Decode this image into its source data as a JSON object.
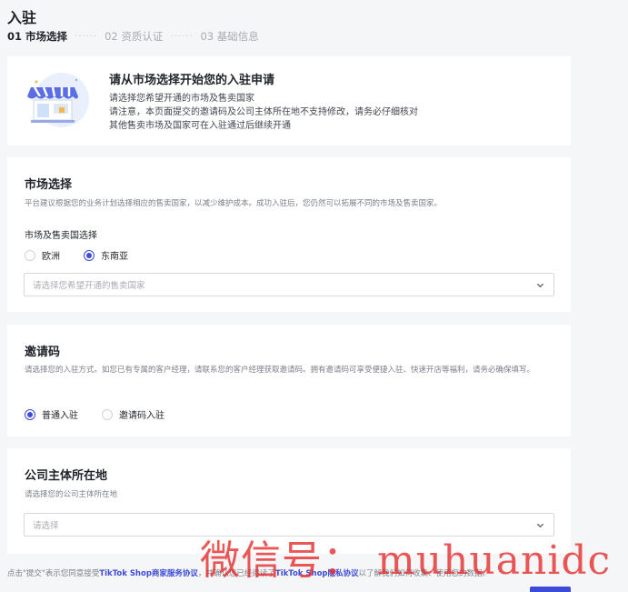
{
  "page": {
    "title": "入驻"
  },
  "steps": [
    {
      "label": "01 市场选择",
      "active": true
    },
    {
      "label": "02 资质认证",
      "active": false
    },
    {
      "label": "03 基础信息",
      "active": false
    }
  ],
  "step_separator": "······",
  "hero": {
    "title": "请从市场选择开始您的入驻申请",
    "lines": [
      "请选择您希望开通的市场及售卖国家",
      "请注意，本页面提交的邀请码及公司主体所在地不支持修改，请务必仔细核对",
      "其他售卖市场及国家可在入驻通过后继续开通"
    ]
  },
  "market": {
    "title": "市场选择",
    "desc": "平台建议根据您的业务计划选择相应的售卖国家，以减少维护成本。成功入驻后，您仍然可以拓展不同的市场及售卖国家。",
    "field_label": "市场及售卖国选择",
    "options": [
      {
        "label": "欧洲",
        "checked": false
      },
      {
        "label": "东南亚",
        "checked": true
      }
    ],
    "select_placeholder": "请选择您希望开通的售卖国家"
  },
  "invite": {
    "title": "邀请码",
    "desc": "请选择您的入驻方式。如您已有专属的客户经理，请联系您的客户经理获取邀请码。拥有邀请码可享受便捷入驻、快速开店等福利，请务必确保填写。",
    "options": [
      {
        "label": "普通入驻",
        "checked": true
      },
      {
        "label": "邀请码入驻",
        "checked": false
      }
    ]
  },
  "company": {
    "title": "公司主体所在地",
    "desc": "请选择您的公司主体所在地",
    "select_placeholder": "请选择"
  },
  "footer": {
    "prefix": "点击\"提交\"表示您同意接受",
    "link1": "TikTok Shop商家服务协议",
    "middle": "，并确认您已经阅读了",
    "link2": "TikTok Shop隐私协议",
    "suffix": "以了解我们如何收集、使用您的数据。"
  },
  "watermark": "微信号： muhuanidc",
  "colors": {
    "accent": "#3d4bd6",
    "watermark": "#e62828"
  }
}
